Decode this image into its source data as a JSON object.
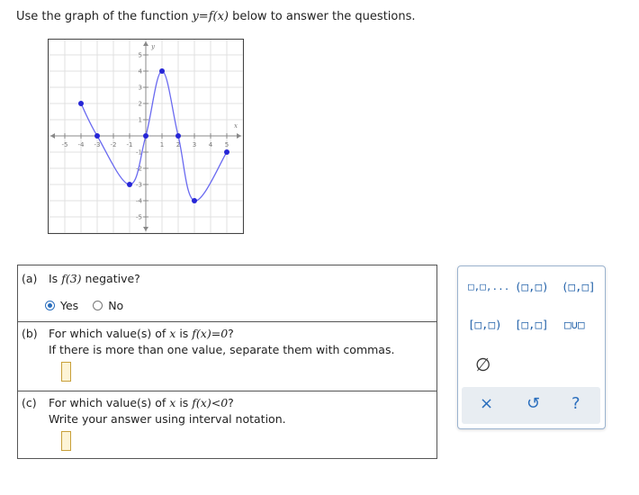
{
  "instruction": {
    "prefix": "Use the graph of the function ",
    "func": "y=f(x)",
    "suffix": " below to answer the questions."
  },
  "graph": {
    "x_axis_label": "x",
    "y_axis_label": "y",
    "x_tick_labels": [
      "-5",
      "-4",
      "-3",
      "-2",
      "-1",
      "1",
      "2",
      "3",
      "4",
      "5"
    ],
    "y_tick_labels": [
      "5",
      "4",
      "3",
      "2",
      "1",
      "-1",
      "-2",
      "-3",
      "-4",
      "-5"
    ],
    "points": [
      [
        -4,
        2
      ],
      [
        -3,
        0
      ],
      [
        -1,
        -3
      ],
      [
        0,
        0
      ],
      [
        1,
        4
      ],
      [
        2,
        0
      ],
      [
        3,
        -4
      ],
      [
        5,
        -1
      ]
    ],
    "line_color": "#6a6af0",
    "point_color": "#2626d6"
  },
  "questions": {
    "a": {
      "label": "(a)",
      "text_prefix": "Is ",
      "expr": "f(3)",
      "text_suffix": " negative?",
      "options": [
        "Yes",
        "No"
      ],
      "selected": "Yes"
    },
    "b": {
      "label": "(b)",
      "text_prefix": "For which value(s) of ",
      "var": "x",
      "text_mid": " is ",
      "expr": "f(x)=0",
      "text_suffix": "?",
      "line2": "If there is more than one value, separate them with commas."
    },
    "c": {
      "label": "(c)",
      "text_prefix": "For which value(s) of ",
      "var": "x",
      "text_mid": " is ",
      "expr": "f(x)<0",
      "text_suffix": "?",
      "line2": "Write your answer using interval notation."
    }
  },
  "palette": {
    "buttons": [
      "□,□,...",
      "(□,□)",
      "(□,□]",
      "[□,□)",
      "[□,□]",
      "□∪□"
    ],
    "empty_set": "∅",
    "clear": "×",
    "undo": "↺",
    "help": "?"
  }
}
